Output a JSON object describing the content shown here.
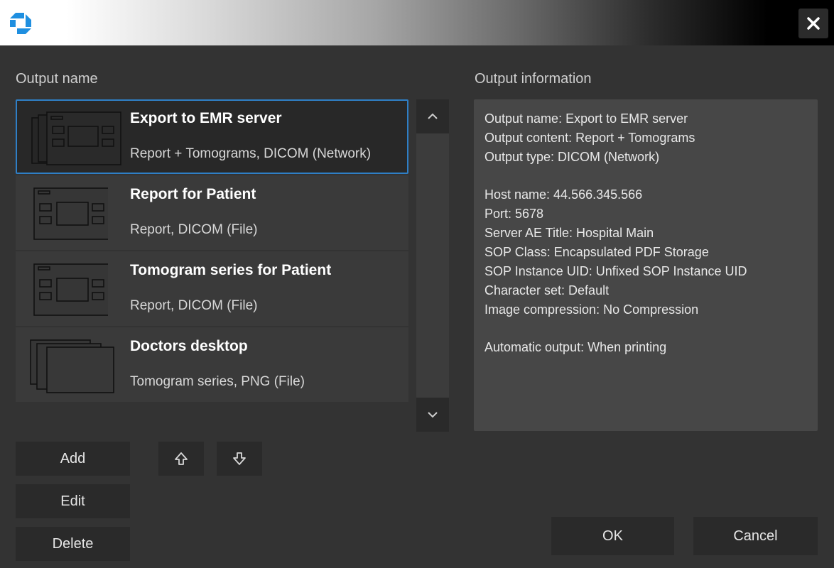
{
  "window": {
    "logo_icon": "app-logo-icon",
    "close_icon": "close-icon"
  },
  "labels": {
    "output_name": "Output name",
    "output_information": "Output information"
  },
  "outputs": [
    {
      "name": "Export to EMR server",
      "description": "Report + Tomograms, DICOM (Network)",
      "icon": "report-tomograms-icon",
      "selected": true
    },
    {
      "name": "Report for Patient",
      "description": "Report, DICOM (File)",
      "icon": "report-icon",
      "selected": false
    },
    {
      "name": "Tomogram series for Patient",
      "description": "Report, DICOM (File)",
      "icon": "report-icon",
      "selected": false
    },
    {
      "name": "Doctors desktop",
      "description": "Tomogram series, PNG (File)",
      "icon": "tomogram-series-icon",
      "selected": false
    }
  ],
  "info": {
    "output_name": "Output name:  Export to EMR server",
    "output_content": "Output content:  Report + Tomograms",
    "output_type": "Output type:  DICOM (Network)",
    "host_name": "Host name:  44.566.345.566",
    "port": "Port:  5678",
    "server_ae_title": "Server AE Title:  Hospital Main",
    "sop_class": "SOP Class:  Encapsulated PDF Storage",
    "sop_instance_uid": "SOP Instance UID:  Unfixed SOP Instance UID",
    "character_set": "Character set:  Default",
    "image_compression": "Image compression:  No Compression",
    "automatic_output": "Automatic output:  When printing"
  },
  "buttons": {
    "add": "Add",
    "edit": "Edit",
    "delete": "Delete",
    "ok": "OK",
    "cancel": "Cancel",
    "move_up_icon": "move-up-icon",
    "move_down_icon": "move-down-icon"
  },
  "colors": {
    "background": "#333333",
    "selection_border": "#2f7fc6",
    "logo_blue": "#1f8fe0"
  }
}
